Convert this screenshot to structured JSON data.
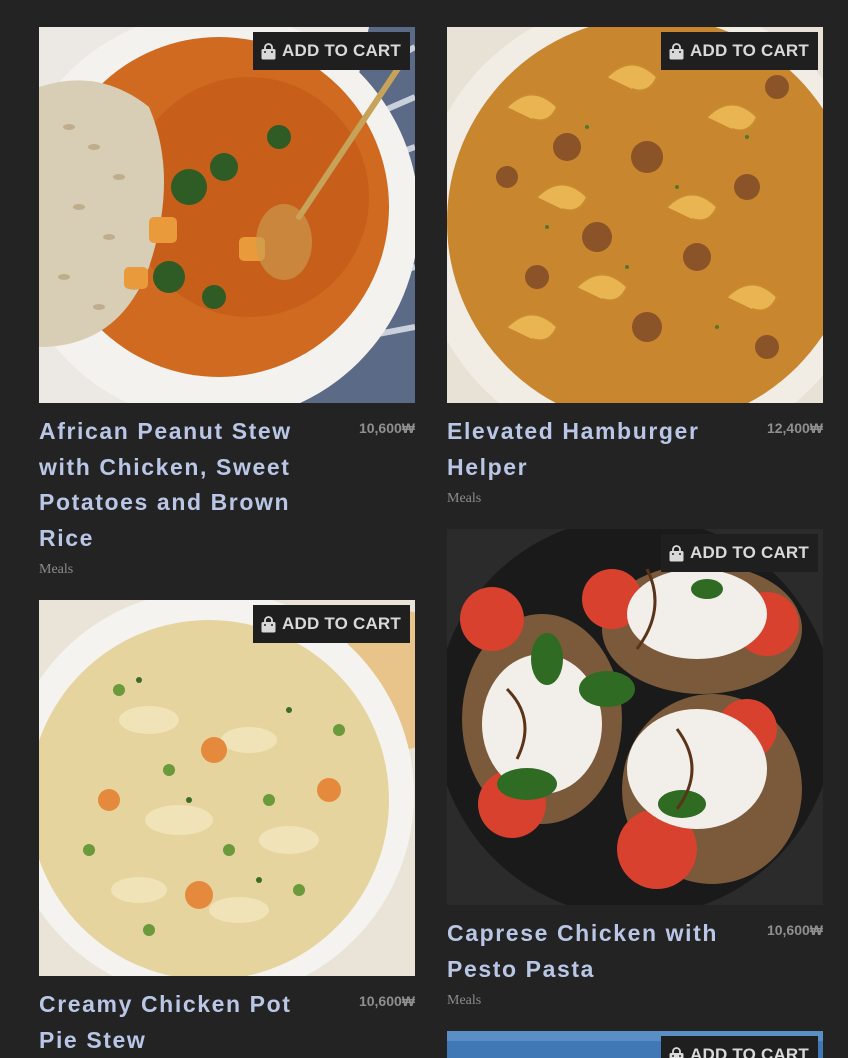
{
  "products": [
    {
      "title": "African Peanut Stew with Chicken, Sweet Potatoes and Brown Rice",
      "price": "10,600₩",
      "category": "Meals",
      "cart_label": "ADD TO CART"
    },
    {
      "title": "Elevated Hamburger Helper",
      "price": "12,400₩",
      "category": "Meals",
      "cart_label": "ADD TO CART"
    },
    {
      "title": "Caprese Chicken with Pesto Pasta",
      "price": "10,600₩",
      "category": "Meals",
      "cart_label": "ADD TO CART"
    },
    {
      "title": "Creamy Chicken Pot Pie Stew",
      "price": "10,600₩",
      "category": "",
      "cart_label": "ADD TO CART"
    },
    {
      "title": "",
      "price": "",
      "category": "",
      "cart_label": "ADD TO CART"
    }
  ],
  "icons": {
    "cart": "shopping-bag-icon"
  },
  "colors": {
    "background": "#232323",
    "title": "#b9c6e6",
    "button_bg": "#1f1f1f"
  }
}
